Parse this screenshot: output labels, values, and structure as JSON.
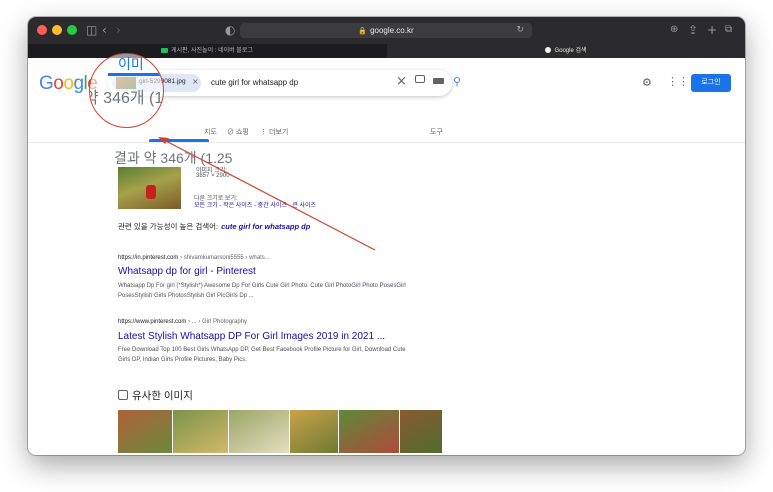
{
  "browser": {
    "address": "google.co.kr",
    "tabs": [
      {
        "label": "게시판, 사진놀이 : 네이버 블로그",
        "favicon_color": "#19c35f"
      },
      {
        "label": "Google 검색",
        "favicon_color": "#f4f4f4"
      }
    ]
  },
  "google": {
    "logo": "Google",
    "chip_label": "girl-5299081.jpg",
    "query": "cute girl for whatsapp dp",
    "login_label": "로그인",
    "nav": {
      "items": [
        "지도",
        "쇼핑",
        "더보기"
      ],
      "tools": "도구"
    }
  },
  "results": {
    "count_text": "결과 약 346개 (1.25",
    "image_size_label": "이미지 크기:",
    "image_size_value": "3857 × 2900",
    "other_sizes_label": "다른 크기로 보기:",
    "other_sizes_links": "모든 크기 - 작은 사이즈 - 중간 사이즈 - 큰 사이즈",
    "related_prefix": "관련 있을 가능성이 높은 검색어:",
    "related_query": "cute girl for whatsapp dp",
    "items": [
      {
        "url": "https://in.pinterest.com",
        "crumb": " › shivamkumarsoni5555 › whats...",
        "title": "Whatsapp dp for girl - Pinterest",
        "snippet": "Whatsapp Dp For girl (*Stylish*) Awesome Dp For Girls Cute Girl Photo. Cute Girl PhotoGirl Photo PosesGirl PosesStylish Girls PhotosStylish Girl PicGirls Dp ..."
      },
      {
        "url": "https://www.pinterest.com",
        "crumb": " › ... › Girl Photography",
        "title": "Latest Stylish Whatsapp DP For Girl Images 2019 in 2021 ...",
        "snippet": "Free Download Top 100 Best Girls WhatsApp DP, Get Best Facebook Profile Picture for Girl, Download Cute Girls DP, Indian Girls Profile Pictures, Baby Pics."
      }
    ],
    "similar_heading": "유사한 이미지"
  },
  "magnifier": {
    "zoom_text": "약 346개 (1.25",
    "zoom_blue": "이미"
  },
  "icons": [
    "sidebar-icon",
    "back-icon",
    "forward-icon",
    "shield-icon",
    "lock-icon",
    "reload-icon",
    "download-icon",
    "share-icon",
    "new-tab-icon",
    "tabs-icon",
    "close-icon",
    "camera-icon",
    "keyboard-icon",
    "search-icon",
    "settings-icon",
    "apps-icon",
    "tag-icon",
    "similar-images-icon"
  ],
  "colors": {
    "titlebar": "#2b2b2d",
    "link": "#1a0dab",
    "accent": "#1a73e8",
    "annotation": "#d44030"
  }
}
